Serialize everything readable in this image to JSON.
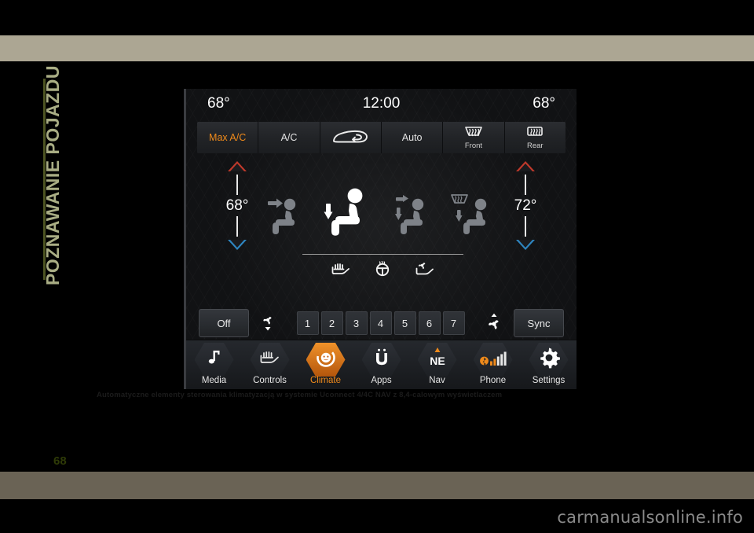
{
  "page": {
    "side_title": "POZNAWANIE POJAZDU",
    "page_number": "68",
    "caption": "Automatyczne elementy sterowania klimatyzacją w systemie Uconnect 4/4C NAV z 8,4-calowym wyświetlaczem",
    "watermark": "carmanualsonline.info",
    "accent_orange": "#ef8a1b",
    "side_title_color": "#a9ad84",
    "band_color": "#aca693"
  },
  "screen": {
    "status": {
      "left_temp": "68°",
      "clock": "12:00",
      "right_temp": "68°"
    },
    "top_buttons": [
      {
        "label": "Max A/C",
        "sublabel": "",
        "icon": "",
        "active": true
      },
      {
        "label": "A/C",
        "sublabel": "",
        "icon": "",
        "active": false
      },
      {
        "label": "",
        "sublabel": "",
        "icon": "recirculation-icon",
        "active": false
      },
      {
        "label": "Auto",
        "sublabel": "",
        "icon": "",
        "active": false
      },
      {
        "label": "",
        "sublabel": "Front",
        "icon": "front-defrost-icon",
        "active": false
      },
      {
        "label": "",
        "sublabel": "Rear",
        "icon": "rear-defrost-icon",
        "active": false
      }
    ],
    "temp_left": {
      "value": "68°",
      "up_icon": "triangle-up-icon",
      "down_icon": "triangle-down-icon",
      "up_color": "#c0392b",
      "down_color": "#2e86c1"
    },
    "temp_right": {
      "value": "72°",
      "up_icon": "triangle-up-icon",
      "down_icon": "triangle-down-icon",
      "up_color": "#c0392b",
      "down_color": "#2e86c1"
    },
    "airflow_modes": [
      {
        "name": "mode-face-icon",
        "active": false
      },
      {
        "name": "mode-face-floor-icon",
        "active": true
      },
      {
        "name": "mode-floor-icon",
        "active": false
      },
      {
        "name": "mode-defrost-floor-icon",
        "active": false
      }
    ],
    "comfort_icons": [
      {
        "name": "heated-seat-icon"
      },
      {
        "name": "heated-steering-wheel-icon"
      },
      {
        "name": "ventilated-seat-icon"
      }
    ],
    "fan_row": {
      "off_label": "Off",
      "sync_label": "Sync",
      "fan_down_icon": "fan-decrease-icon",
      "fan_up_icon": "fan-increase-icon",
      "speeds": [
        "1",
        "2",
        "3",
        "4",
        "5",
        "6",
        "7"
      ]
    },
    "nav": [
      {
        "label": "Media",
        "icon": "music-note-icon",
        "active": false
      },
      {
        "label": "Controls",
        "icon": "heated-seat-icon",
        "active": false
      },
      {
        "label": "Climate",
        "icon": "climate-fan-icon",
        "active": true
      },
      {
        "label": "Apps",
        "icon": "uconnect-u-icon",
        "active": false
      },
      {
        "label": "Nav",
        "icon": "compass-ne-icon",
        "active": false,
        "badge": "NE"
      },
      {
        "label": "Phone",
        "icon": "signal-bars-icon",
        "active": false
      },
      {
        "label": "Settings",
        "icon": "gear-icon",
        "active": false
      }
    ]
  }
}
